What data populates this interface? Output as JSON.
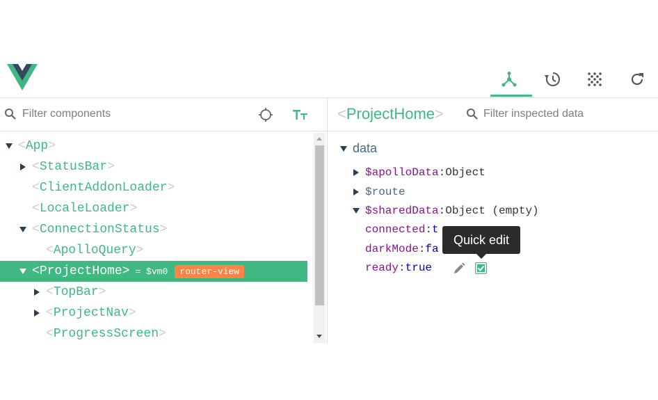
{
  "header": {
    "logo_icon": "vue-logo-icon",
    "tabs": [
      {
        "icon": "components-tree-icon",
        "active": true
      },
      {
        "icon": "history-icon",
        "active": false
      },
      {
        "icon": "vuex-grid-icon",
        "active": false
      },
      {
        "icon": "refresh-icon",
        "active": false
      }
    ],
    "accent_color": "#41b883"
  },
  "components_panel": {
    "filter_placeholder": "Filter components",
    "select_target_icon": "crosshair-icon",
    "font_size_icon": "text-size-icon",
    "tree": [
      {
        "name": "App",
        "depth": 0,
        "toggle": "expanded",
        "lt": "<",
        "gt": ">"
      },
      {
        "name": "StatusBar",
        "depth": 1,
        "toggle": "collapsed",
        "lt": "<",
        "gt": ">"
      },
      {
        "name": "ClientAddonLoader",
        "depth": 1,
        "toggle": "none",
        "lt": "<",
        "gt": ">"
      },
      {
        "name": "LocaleLoader",
        "depth": 1,
        "toggle": "none",
        "lt": "<",
        "gt": ">"
      },
      {
        "name": "ConnectionStatus",
        "depth": 1,
        "toggle": "expanded",
        "lt": "<",
        "gt": ">"
      },
      {
        "name": "ApolloQuery",
        "depth": 2,
        "toggle": "none",
        "lt": "<",
        "gt": ">"
      },
      {
        "name": "ProjectHome",
        "depth": 1,
        "toggle": "expanded",
        "lt": "<",
        "gt": ">",
        "selected": true,
        "vm": "= $vm0",
        "badge": "router-view"
      },
      {
        "name": "TopBar",
        "depth": 2,
        "toggle": "collapsed",
        "lt": "<",
        "gt": ">"
      },
      {
        "name": "ProjectNav",
        "depth": 2,
        "toggle": "collapsed",
        "lt": "<",
        "gt": ">"
      },
      {
        "name": "ProgressScreen",
        "depth": 2,
        "toggle": "none",
        "lt": "<",
        "gt": ">"
      }
    ]
  },
  "inspector": {
    "title_lt": "<",
    "title": "ProjectHome",
    "title_gt": ">",
    "filter_placeholder": "Filter inspected data",
    "section": "data",
    "props": [
      {
        "key": "$apolloData",
        "colon": ":",
        "value": "Object",
        "toggle": "collapsed"
      },
      {
        "key": "$route",
        "colon": "",
        "value": "",
        "toggle": "collapsed"
      },
      {
        "key": "$sharedData",
        "colon": ":",
        "value": "Object (empty)",
        "toggle": "expanded"
      },
      {
        "key": "connected",
        "colon": ":",
        "value": "t",
        "toggle": "none"
      },
      {
        "key": "darkMode",
        "colon": ":",
        "value": "fa",
        "toggle": "none"
      },
      {
        "key": "ready",
        "colon": ":",
        "value": "true",
        "toggle": "none"
      }
    ],
    "edit_icon": "pencil-icon",
    "checkbox_icon": "checkbox-checked-icon",
    "tooltip": "Quick edit"
  }
}
